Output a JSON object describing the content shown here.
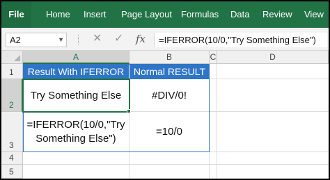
{
  "ribbon": {
    "tabs": [
      "File",
      "Home",
      "Insert",
      "Page Layout",
      "Formulas",
      "Data",
      "Review",
      "View"
    ]
  },
  "formula_bar": {
    "name_box": "A2",
    "cancel_icon": "✕",
    "enter_icon": "✓",
    "fx_label": "fx",
    "formula": "=IFERROR(10/0,\"Try Something Else\")"
  },
  "grid": {
    "columns": [
      "A",
      "B",
      "C",
      "D"
    ],
    "rows": [
      "1",
      "2",
      "3",
      "4",
      "5"
    ],
    "selected_cell": "A2",
    "cells": {
      "A1": "Result With IFERROR",
      "B1": "Normal RESULT",
      "A2": "Try Something Else",
      "B2": "#DIV/0!",
      "A3_line1": "=IFERROR(10/0,\"Try",
      "A3_line2": "Something Else\")",
      "B3": "=10/0"
    }
  },
  "colors": {
    "ribbon": "#217346",
    "header_fill": "#2f75c6",
    "selection": "#217346"
  }
}
